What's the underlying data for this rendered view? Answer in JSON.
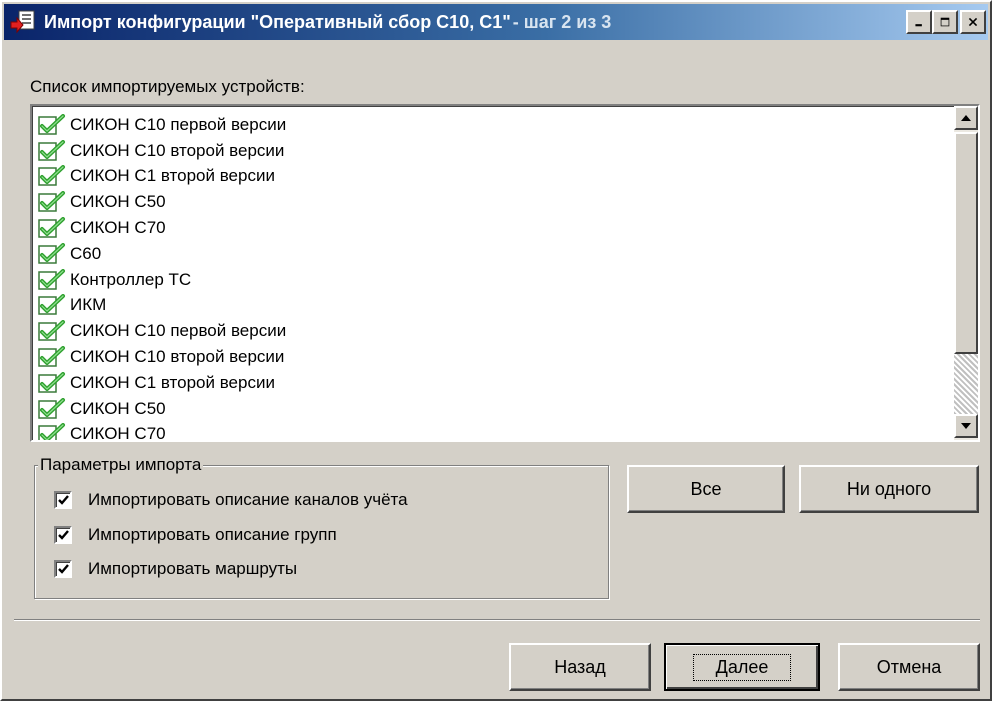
{
  "window": {
    "title": "Импорт конфигурации \"Оперативный сбор С10, С1\"",
    "title_step": "- шаг 2 из 3",
    "controls": {
      "minimize": "_",
      "maximize": "□",
      "close": "×"
    }
  },
  "device_list": {
    "label": "Список импортируемых устройств:",
    "items": [
      "СИКОН С10 первой версии",
      "СИКОН С10 второй версии",
      "СИКОН С1 второй версии",
      "СИКОН С50",
      "СИКОН С70",
      "С60",
      "Контроллер ТС",
      "ИКМ",
      "СИКОН С10 первой версии",
      "СИКОН С10 второй версии",
      "СИКОН С1 второй версии",
      "СИКОН С50",
      "СИКОН С70"
    ],
    "item_icon": "green-check-icon"
  },
  "import_params": {
    "legend": "Параметры импорта",
    "options": [
      {
        "label": "Импортировать описание каналов учёта",
        "checked": true
      },
      {
        "label": "Импортировать описание групп",
        "checked": true
      },
      {
        "label": "Импортировать маршруты",
        "checked": true
      }
    ]
  },
  "selection_buttons": {
    "all": "Все",
    "none": "Ни одного"
  },
  "footer": {
    "back": "Назад",
    "next": "Далее",
    "cancel": "Отмена"
  },
  "colors": {
    "face": "#d4d0c8",
    "title_start": "#0a246a",
    "title_end": "#a6caf0",
    "check_green": "#2fa02f"
  }
}
